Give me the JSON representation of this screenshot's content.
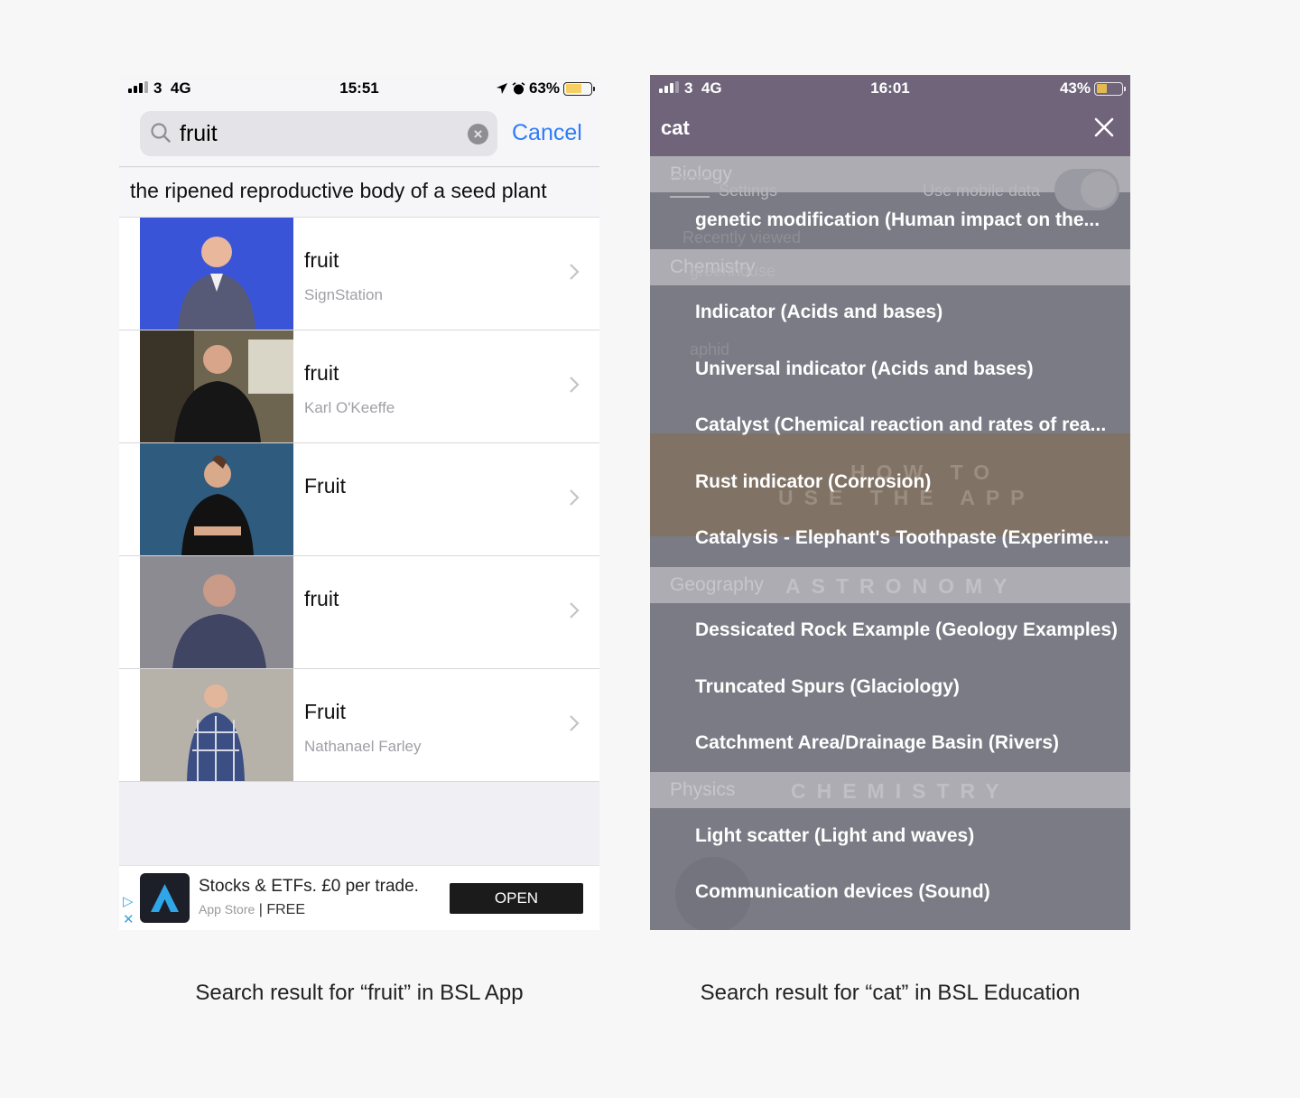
{
  "left_phone": {
    "status": {
      "carrier": "3",
      "network": "4G",
      "time": "15:51",
      "battery": "63%",
      "battery_level": 0.63
    },
    "search": {
      "query": "fruit",
      "cancel_label": "Cancel"
    },
    "definition": "the ripened reproductive body of a seed plant",
    "results": [
      {
        "title": "fruit",
        "author": "SignStation"
      },
      {
        "title": "fruit",
        "author": "Karl O'Keeffe"
      },
      {
        "title": "Fruit",
        "author": ""
      },
      {
        "title": "fruit",
        "author": ""
      },
      {
        "title": "Fruit",
        "author": "Nathanael Farley"
      }
    ],
    "ad": {
      "headline": "Stocks & ETFs. £0 per trade.",
      "store": "App Store",
      "price": "| FREE",
      "open_label": "OPEN"
    },
    "caption": "Search result for “fruit” in BSL App"
  },
  "right_phone": {
    "status": {
      "carrier": "3",
      "network": "4G",
      "time": "16:01",
      "battery": "43%",
      "battery_level": 0.43
    },
    "query": "cat",
    "results": [
      "genetic modification (Human impact on the...",
      "Indicator (Acids and bases)",
      "Universal indicator (Acids and bases)",
      "Catalyst (Chemical reaction and rates of rea...",
      "Rust indicator (Corrosion)",
      "Catalysis - Elephant's Toothpaste (Experime...",
      "Dessicated Rock Example (Geology Examples)",
      "Truncated Spurs (Glaciology)",
      "Catchment Area/Drainage Basin (Rivers)",
      "Light scatter (Light and waves)",
      "Communication devices (Sound)"
    ],
    "background_ghost": {
      "biology": "Biology",
      "settings": "Settings",
      "use_mobile_data": "Use mobile data",
      "recently_viewed": "Recently viewed",
      "chemistry": "Chemistry",
      "greenhouse": "greenhouse",
      "aphid": "aphid",
      "how_to": "HOW TO",
      "use_the_app": "USE THE APP",
      "geography": "Geography",
      "astronomy": "ASTRONOMY",
      "physics": "Physics",
      "chemistry_banner": "CHEMISTRY"
    },
    "caption": "Search result for “cat” in BSL Education"
  },
  "colors": {
    "ios_blue": "#2f7cf6",
    "purple_header": "#6f6479",
    "overlay_gray": "#7b7b85"
  }
}
